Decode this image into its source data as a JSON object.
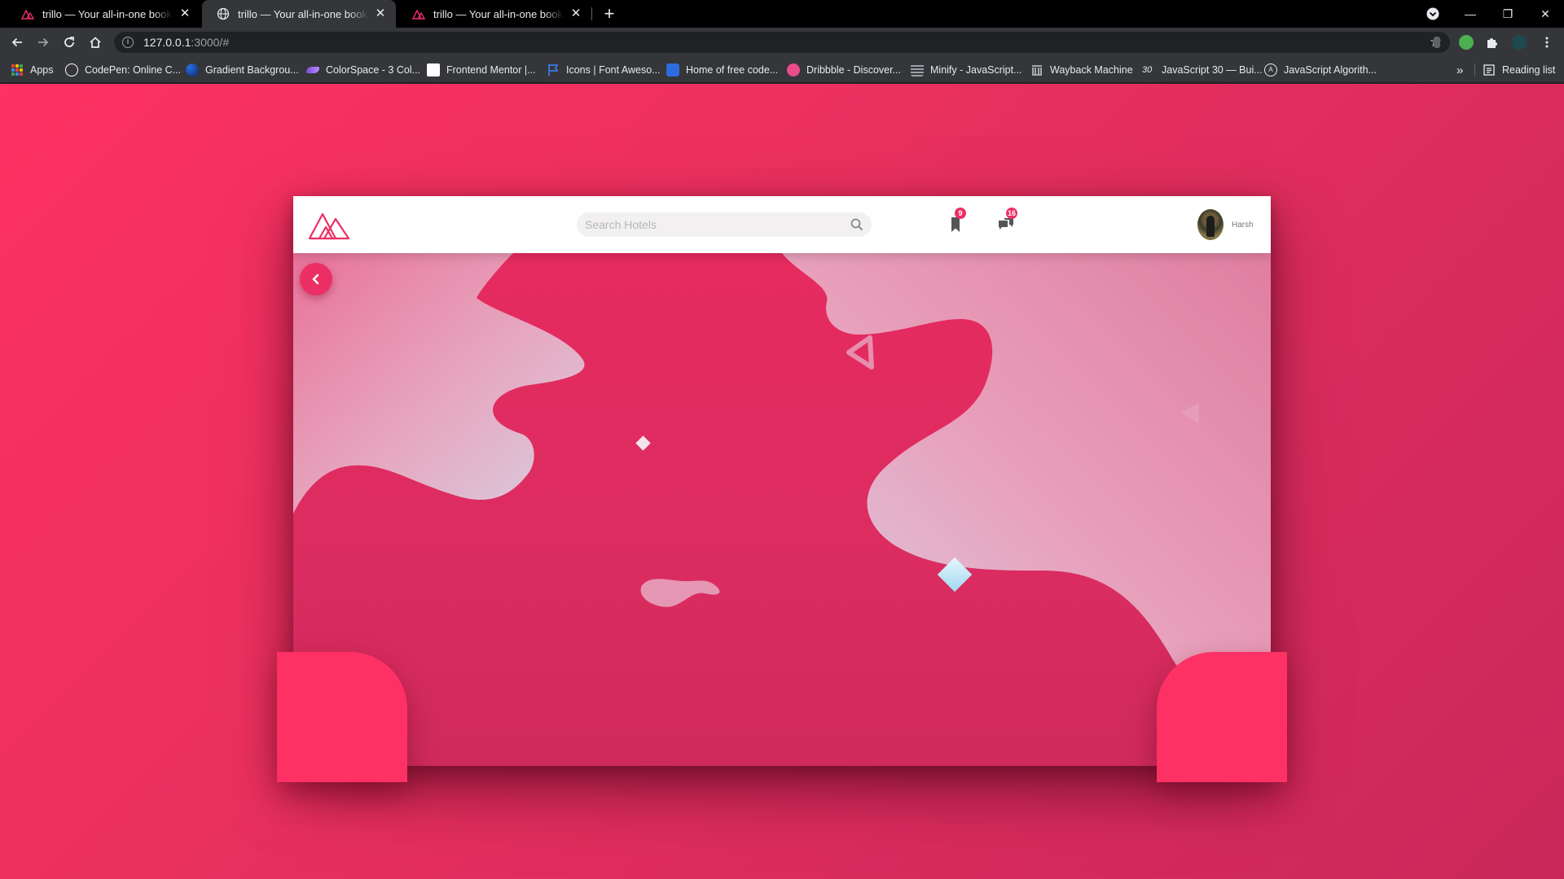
{
  "browser": {
    "tabs": [
      {
        "title": "trillo — Your all-in-one booking app",
        "active": false,
        "icon": "trillo-logo-icon"
      },
      {
        "title": "trillo — Your all-in-one booking app",
        "active": true,
        "icon": "globe-icon"
      },
      {
        "title": "trillo — Your all-in-one booking app",
        "active": false,
        "icon": "trillo-logo-icon"
      }
    ],
    "tab_close_glyph": "✕",
    "new_tab_glyph": "+",
    "window_controls": {
      "minimize": "—",
      "restore": "❐",
      "close": "✕"
    },
    "url_host": "127.0.0.1",
    "url_rest": ":3000/#",
    "bookmarks": [
      {
        "label": "Apps",
        "icon": "apps-grid-icon"
      },
      {
        "label": "CodePen: Online C...",
        "icon": "codepen-icon",
        "color": "#ffffff"
      },
      {
        "label": "Gradient Backgrou...",
        "icon": "gradient-icon",
        "color": "#2b6de0"
      },
      {
        "label": "ColorSpace - 3 Col...",
        "icon": "colorspace-icon",
        "color": "#7b4fd8"
      },
      {
        "label": "Frontend Mentor |...",
        "icon": "frontend-mentor-icon",
        "color": "#ffffff"
      },
      {
        "label": "Icons | Font Aweso...",
        "icon": "flag-icon",
        "color": "#3b82f6"
      },
      {
        "label": "Home of free code...",
        "icon": "freecodecamp-icon",
        "color": "#2d6cdf"
      },
      {
        "label": "Dribbble - Discover...",
        "icon": "dribbble-icon",
        "color": "#ea4c89"
      },
      {
        "label": "Minify - JavaScript...",
        "icon": "minify-icon",
        "color": "#9aa0a6"
      },
      {
        "label": "Wayback Machine",
        "icon": "wayback-icon",
        "color": "#e8eaed"
      },
      {
        "label": "JavaScript 30 — Bui...",
        "icon": "js30-icon",
        "color": "#e8eaed"
      },
      {
        "label": "JavaScript Algorith...",
        "icon": "js-algorithms-icon",
        "color": "#e8eaed"
      }
    ],
    "bookmarks_overflow": "»",
    "reading_list": "Reading list"
  },
  "app": {
    "search_placeholder": "Search Hotels",
    "bookmark_count": "9",
    "chat_count": "16",
    "user_name": "Harsh"
  },
  "colors": {
    "primary": "#eb2f64",
    "bright": "#fd3163",
    "hero": "#e62b5f"
  }
}
